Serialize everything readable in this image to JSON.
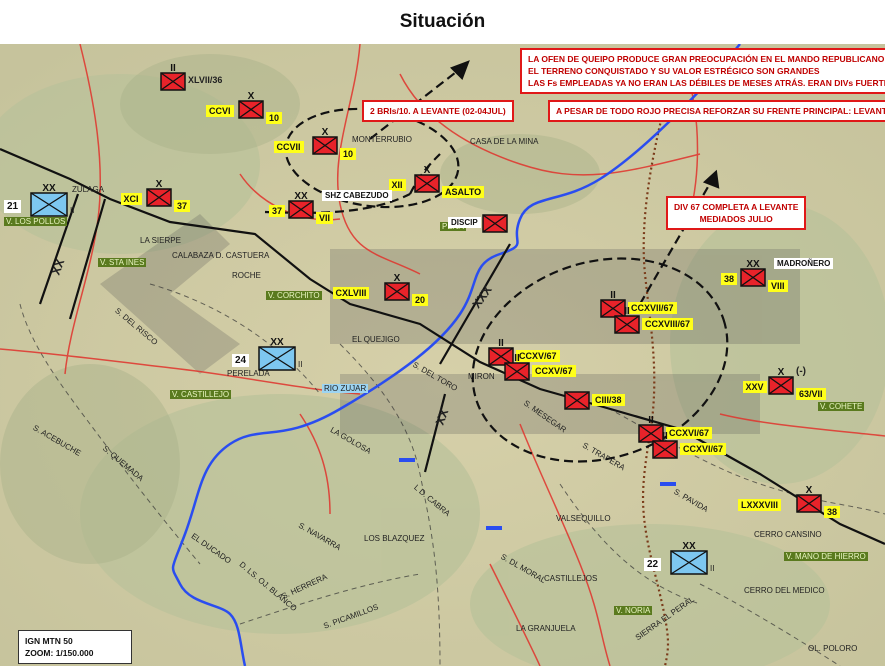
{
  "title": "Situación",
  "notes": {
    "main": [
      "LA OFEN DE QUEIPO PRODUCE GRAN PREOCUPACIÓN EN EL MANDO REPUBLICANO",
      "EL TERRENO CONQUISTADO Y SU VALOR ESTRÉGICO SON GRANDES",
      "LAS Fs EMPLEADAS YA NO ERAN LAS DÉBILES DE MESES ATRÁS. ERAN DIVs FUERTES"
    ],
    "refuerzo": "A PESAR DE TODO ROJO PRECISA REFORZAR SU FRENTE PRINCIPAL: LEVANTE",
    "bris": "2 BRIs/10. A  LEVANTE (02-04JUL)",
    "div67": [
      "DIV 67 COMPLETA A LEVANTE",
      "MEDIADOS JULIO"
    ]
  },
  "map_info": [
    "IGN MTN 50",
    "ZOOM: 1/150.000"
  ],
  "units": {
    "red": [
      {
        "id": "XLVII/36",
        "size": "II"
      },
      {
        "id": "CCVI",
        "num": "10",
        "size": "X"
      },
      {
        "id": "CCVII",
        "num": "10",
        "size": "X"
      },
      {
        "id": "XII",
        "num": "ASALTO",
        "size": "X"
      },
      {
        "id": "XCI",
        "num": "37",
        "size": "X"
      },
      {
        "id": "37",
        "num": "VII",
        "size": "XX",
        "tag": "SHZ CABEZUDO"
      },
      {
        "id": "DISCIP",
        "size": ""
      },
      {
        "id": "CXLVIII",
        "num": "20",
        "size": "X"
      },
      {
        "id": "38",
        "num": "VIII",
        "size": "XX",
        "tag": "MADROÑERO"
      },
      {
        "id": "CCXVII/67",
        "size": "II"
      },
      {
        "id": "CCXVIII/67",
        "size": "II"
      },
      {
        "id": "CCXV/67",
        "size": "II"
      },
      {
        "id": "CCXV/67",
        "size": "II"
      },
      {
        "id": "CIII/38",
        "size": ""
      },
      {
        "id": "XXV",
        "num": "63/VII",
        "size": "X",
        "extra": "(-)"
      },
      {
        "id": "CCXVI/67",
        "size": "II"
      },
      {
        "id": "CCXVI/67",
        "size": "II"
      },
      {
        "id": "LXXXVIII",
        "num": "38",
        "size": "X"
      }
    ],
    "blue": [
      {
        "id": "21",
        "size": "XX",
        "suffix": "II"
      },
      {
        "id": "24",
        "size": "XX",
        "suffix": "II"
      },
      {
        "id": "22",
        "size": "XX",
        "suffix": "II"
      }
    ]
  },
  "boundaries": [
    "XXX",
    "XX",
    "XX"
  ],
  "places": [
    "MONTERRUBIO",
    "CASA DE LA MINA",
    "PEÑA",
    "ZULAGA",
    "V. LOS POLLOS",
    "V. STA INES",
    "LA SIERPE",
    "CALABAZA D. CASTUERA",
    "ROCHE",
    "V. CORCHITO",
    "S. DEL RISCO",
    "EL QUEJIGO",
    "PERELADA",
    "V. CASTILLEJO",
    "RIO ZUJAR",
    "S. DEL TORO",
    "MIRON",
    "S. MESEGAR",
    "S. TRAPERA",
    "V. COHETE",
    "S. ACEBUCHE",
    "S. QUEMADA",
    "LA GOLOSA",
    "L D. CABRA",
    "S. PAVIDA",
    "LOS BLAZQUEZ",
    "S. NAVARRA",
    "EL DUCADO",
    "D. LS. OJ. BLANCO",
    "S. HERRERA",
    "S. PICAMILLOS",
    "S. DL MORAL",
    "CASTILLEJOS",
    "VALSEQUILLO",
    "CERRO CANSINO",
    "V. MANO DE HIERRO",
    "CERRO DEL MEDICO",
    "V. NORIA",
    "LA GRANJUELA",
    "SIERRA EL PERAL",
    "OL. POLORO"
  ]
}
